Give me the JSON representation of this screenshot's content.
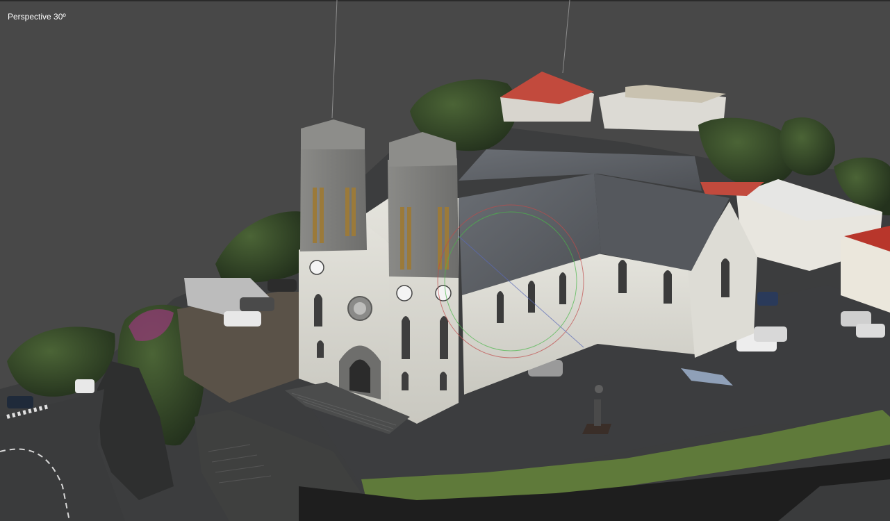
{
  "viewport": {
    "projection_label": "Perspective 30º",
    "background_color": "#484848"
  },
  "scene": {
    "subject": "photogrammetry-mesh-cathedral",
    "colors": {
      "roof": "#5c6066",
      "facade": "#d8d7d0",
      "stone": "#7d7d7a",
      "asphalt": "#3e3f40",
      "grass": "#5f7a3a",
      "foliage": "#33452a",
      "red_roof": "#c04a3c"
    }
  }
}
